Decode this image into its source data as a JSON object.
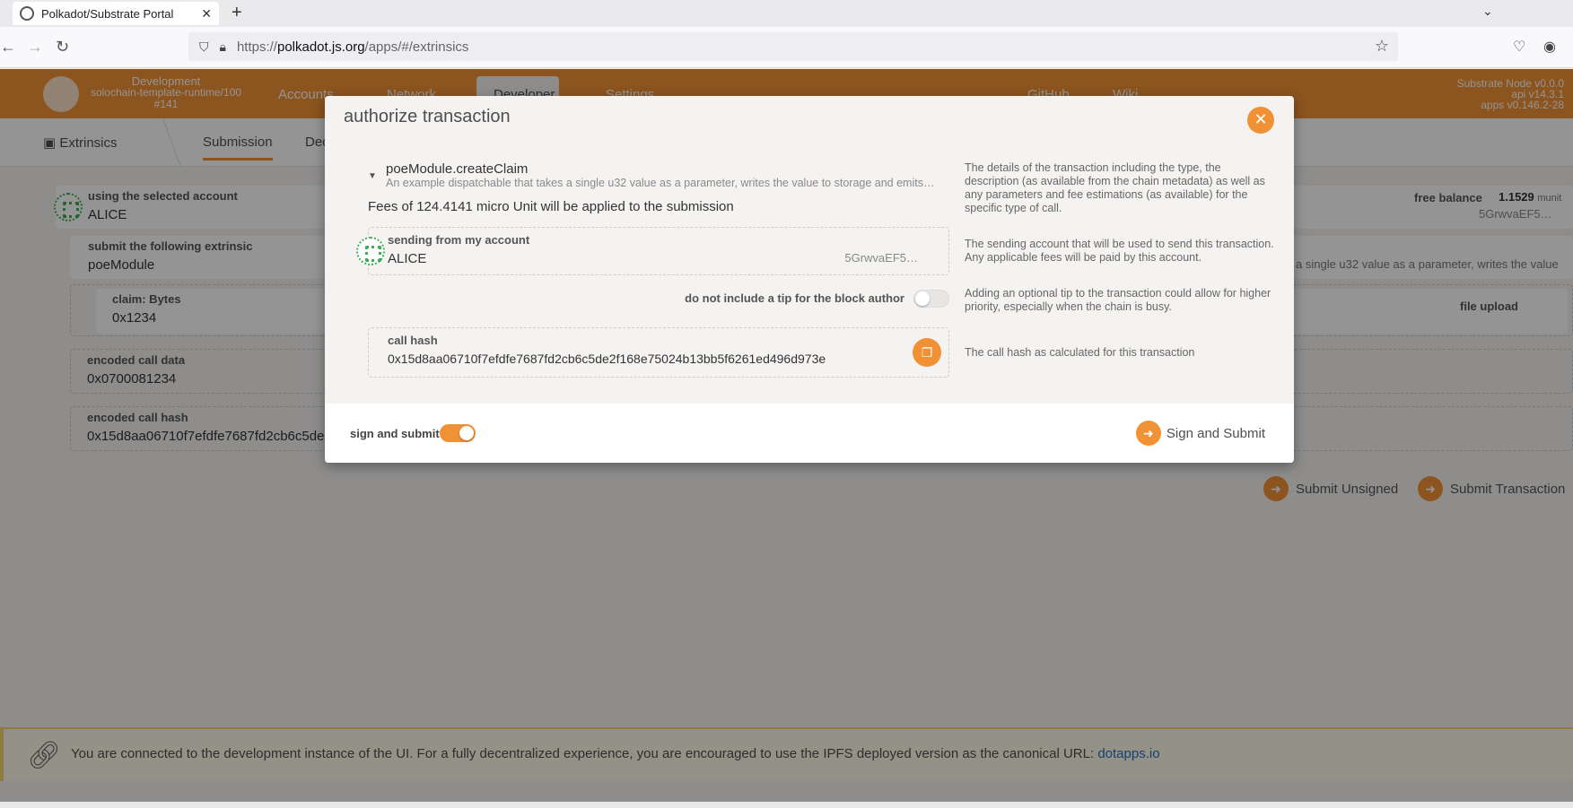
{
  "browser": {
    "tab_title": "Polkadot/Substrate Portal",
    "url_prefix": "https://",
    "url_host": "polkadot.js.org",
    "url_path": "/apps/#/extrinsics"
  },
  "header": {
    "chain_label": "Development",
    "chain_runtime": "solochain-template-runtime/100",
    "chain_block": "#141",
    "menu": [
      "Accounts",
      "Network",
      "Developer",
      "Settings",
      "GitHub",
      "Wiki"
    ],
    "node_info": [
      "Substrate Node v0.0.0",
      "api v14.3.1",
      "apps v0.146.2-28"
    ]
  },
  "subnav": {
    "section": "Extrinsics",
    "tabs": [
      "Submission",
      "Dec"
    ]
  },
  "form": {
    "account_label": "using the selected account",
    "account_name": "ALICE",
    "balance_label": "free balance",
    "balance_value": "1.1529",
    "balance_unit": "munit",
    "account_addr": "5GrwvaEF5…",
    "extrinsic_label": "submit the following extrinsic",
    "extrinsic_module": "poeModule",
    "extrinsic_desc_tail": "a single u32 value as a parameter, writes the value",
    "claim_label": "claim: Bytes",
    "claim_value": "0x1234",
    "file_upload_label": "file upload",
    "encoded_data_label": "encoded call data",
    "encoded_data_value": "0x0700081234",
    "encoded_hash_label": "encoded call hash",
    "encoded_hash_value": "0x15d8aa06710f7efdfe7687fd2cb6c5de2",
    "submit_unsigned": "Submit Unsigned",
    "submit_transaction": "Submit Transaction"
  },
  "footer": {
    "message": "You are connected to the development instance of the UI. For a fully decentralized experience, you are encouraged to use the IPFS deployed version as the canonical URL:",
    "link": "dotapps.io"
  },
  "modal": {
    "title": "authorize transaction",
    "call_method": "poeModule.createClaim",
    "call_desc": "An example dispatchable that takes a single u32 value as a parameter, writes the value to storage and emits…",
    "fees": "Fees of 124.4141 micro Unit will be applied to the submission",
    "help_details": "The details of the transaction including the type, the description (as available from the chain metadata) as well as any parameters and fee estimations (as available) for the specific type of call.",
    "sending_label": "sending from my account",
    "sending_account": "ALICE",
    "sending_addr": "5GrwvaEF5…",
    "help_sending": "The sending account that will be used to send this transaction. Any applicable fees will be paid by this account.",
    "tip_label": "do not include a tip for the block author",
    "tip_enabled": false,
    "help_tip": "Adding an optional tip to the transaction could allow for higher priority, especially when the chain is busy.",
    "hash_label": "call hash",
    "hash_value": "0x15d8aa06710f7efdfe7687fd2cb6c5de2f168e75024b13bb5f6261ed496d973e",
    "help_hash": "The call hash as calculated for this transaction",
    "sign_label": "sign and submit",
    "sign_enabled": true,
    "sign_button": "Sign and Submit"
  },
  "colors": {
    "accent": "#f19135",
    "background": "#f5f3f1"
  }
}
